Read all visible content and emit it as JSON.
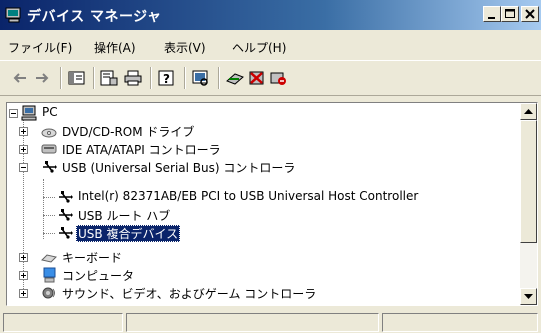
{
  "window": {
    "title": "デバイス マネージャ"
  },
  "menubar": {
    "items": [
      {
        "label": "ファイル(F)"
      },
      {
        "label": "操作(A)"
      },
      {
        "label": "表示(V)"
      },
      {
        "label": "ヘルプ(H)"
      }
    ]
  },
  "toolbar": {
    "icons": [
      "back-arrow-icon",
      "forward-arrow-icon",
      "view-toggle-icon",
      "properties-icon",
      "print-icon",
      "help-icon",
      "scan-hardware-icon",
      "update-driver-icon",
      "uninstall-icon",
      "disable-device-icon"
    ]
  },
  "tree": {
    "root": {
      "label": "PC"
    },
    "items": [
      {
        "label": "DVD/CD-ROM ドライブ",
        "icon": "dvd-drive-icon"
      },
      {
        "label": "IDE ATA/ATAPI コントローラ",
        "icon": "ide-controller-icon"
      },
      {
        "label": "USB (Universal Serial Bus) コントローラ",
        "icon": "usb-icon"
      },
      {
        "label": "Intel(r) 82371AB/EB PCI to USB Universal Host Controller",
        "icon": "usb-icon"
      },
      {
        "label": "USB ルート ハブ",
        "icon": "usb-icon"
      },
      {
        "label": "USB 複合デバイス",
        "icon": "usb-icon"
      },
      {
        "label": "キーボード",
        "icon": "keyboard-icon"
      },
      {
        "label": "コンピュータ",
        "icon": "computer-icon"
      },
      {
        "label": "サウンド、ビデオ、およびゲーム コントローラ",
        "icon": "sound-icon"
      }
    ]
  },
  "colors": {
    "titlebar": "#0a246a",
    "selection": "#0a246a",
    "chrome": "#ece9d8"
  }
}
